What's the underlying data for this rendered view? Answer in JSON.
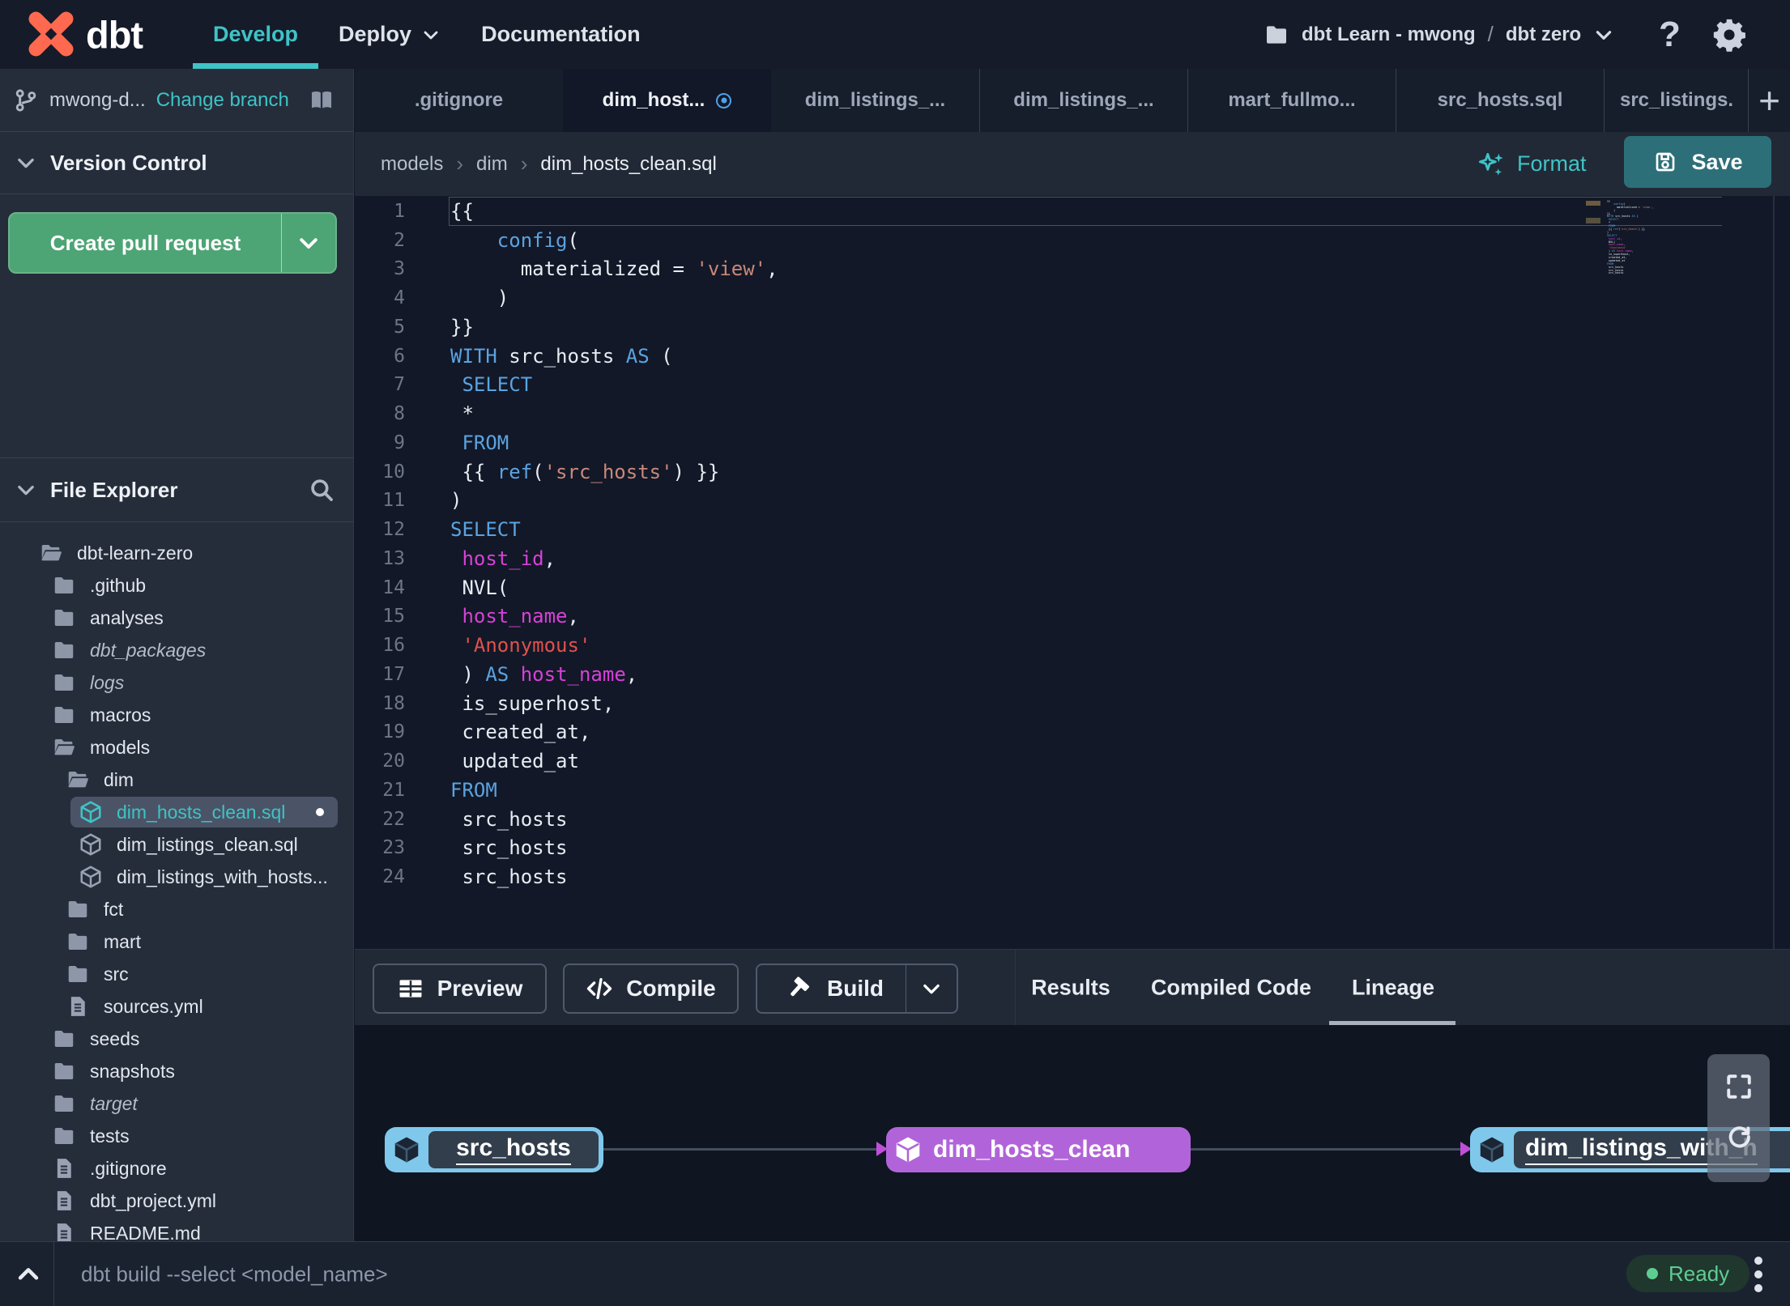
{
  "colors": {
    "accent_teal": "#3fc3c6",
    "logo_orange": "#ff694f",
    "green_button": "#4da475",
    "save_button_teal": "#2d6f78",
    "keyword_blue": "#5ba3e0",
    "string_orange": "#c9887a",
    "string_red": "#e0514d",
    "identifier_magenta": "#d741d7",
    "node_blue": "#7fc8ec",
    "node_purple": "#b164d9",
    "ready_green": "#5ecd92",
    "modified_dot_blue": "#4da3e8"
  },
  "topnav": {
    "brand": "dbt",
    "items": [
      {
        "label": "Develop",
        "active": true,
        "has_dropdown": false
      },
      {
        "label": "Deploy",
        "active": false,
        "has_dropdown": true
      },
      {
        "label": "Documentation",
        "active": false,
        "has_dropdown": false
      }
    ],
    "project_account": "dbt Learn - mwong",
    "project_separator": "/",
    "project_name": "dbt zero",
    "help_label": "?"
  },
  "sidebar": {
    "branch_name": "mwong-d...",
    "change_branch_label": "Change branch",
    "version_control_title": "Version Control",
    "create_pr_label": "Create pull request",
    "file_explorer_title": "File Explorer",
    "tree": [
      {
        "label": "dbt-learn-zero",
        "type": "folder-open",
        "level": 0
      },
      {
        "label": ".github",
        "type": "folder",
        "level": 1
      },
      {
        "label": "analyses",
        "type": "folder",
        "level": 1
      },
      {
        "label": "dbt_packages",
        "type": "folder",
        "level": 1,
        "italic": true
      },
      {
        "label": "logs",
        "type": "folder",
        "level": 1,
        "italic": true
      },
      {
        "label": "macros",
        "type": "folder",
        "level": 1
      },
      {
        "label": "models",
        "type": "folder-open",
        "level": 1
      },
      {
        "label": "dim",
        "type": "folder-open",
        "level": 2
      },
      {
        "label": "dim_hosts_clean.sql",
        "type": "model",
        "level": 3,
        "selected": true,
        "modified": true
      },
      {
        "label": "dim_listings_clean.sql",
        "type": "model",
        "level": 3
      },
      {
        "label": "dim_listings_with_hosts...",
        "type": "model",
        "level": 3
      },
      {
        "label": "fct",
        "type": "folder",
        "level": 2
      },
      {
        "label": "mart",
        "type": "folder",
        "level": 2
      },
      {
        "label": "src",
        "type": "folder",
        "level": 2
      },
      {
        "label": "sources.yml",
        "type": "file",
        "level": 2
      },
      {
        "label": "seeds",
        "type": "folder",
        "level": 1
      },
      {
        "label": "snapshots",
        "type": "folder",
        "level": 1
      },
      {
        "label": "target",
        "type": "folder",
        "level": 1,
        "italic": true
      },
      {
        "label": "tests",
        "type": "folder",
        "level": 1
      },
      {
        "label": ".gitignore",
        "type": "file",
        "level": 1
      },
      {
        "label": "dbt_project.yml",
        "type": "file",
        "level": 1
      },
      {
        "label": "README.md",
        "type": "file",
        "level": 1
      }
    ]
  },
  "tabs": [
    {
      "label": ".gitignore"
    },
    {
      "label": "dim_host...",
      "active": true,
      "modified": true
    },
    {
      "label": "dim_listings_..."
    },
    {
      "label": "dim_listings_..."
    },
    {
      "label": "mart_fullmo..."
    },
    {
      "label": "src_hosts.sql"
    },
    {
      "label": "src_listings.",
      "last": true
    }
  ],
  "editor": {
    "breadcrumb": [
      "models",
      "dim",
      "dim_hosts_clean.sql"
    ],
    "format_label": "Format",
    "save_label": "Save",
    "lines": [
      {
        "n": 1,
        "t": [
          [
            "p",
            "{{"
          ]
        ]
      },
      {
        "n": 2,
        "t": [
          [
            "p",
            "    "
          ],
          [
            "k",
            "config"
          ],
          [
            "p",
            "("
          ]
        ]
      },
      {
        "n": 3,
        "t": [
          [
            "p",
            "      materialized = "
          ],
          [
            "s",
            "'view'"
          ],
          [
            "p",
            ","
          ]
        ]
      },
      {
        "n": 4,
        "t": [
          [
            "p",
            "    )"
          ]
        ]
      },
      {
        "n": 5,
        "t": [
          [
            "p",
            "}}"
          ]
        ]
      },
      {
        "n": 6,
        "t": [
          [
            "k",
            "WITH"
          ],
          [
            "p",
            " src_hosts "
          ],
          [
            "k",
            "AS"
          ],
          [
            "p",
            " ("
          ]
        ]
      },
      {
        "n": 7,
        "t": [
          [
            "p",
            " "
          ],
          [
            "k",
            "SELECT"
          ]
        ]
      },
      {
        "n": 8,
        "t": [
          [
            "p",
            " *"
          ]
        ]
      },
      {
        "n": 9,
        "t": [
          [
            "p",
            " "
          ],
          [
            "k",
            "FROM"
          ]
        ]
      },
      {
        "n": 10,
        "t": [
          [
            "p",
            " {{ "
          ],
          [
            "k",
            "ref"
          ],
          [
            "p",
            "("
          ],
          [
            "s",
            "'src_hosts'"
          ],
          [
            "p",
            ") }}"
          ]
        ]
      },
      {
        "n": 11,
        "t": [
          [
            "p",
            ")"
          ]
        ]
      },
      {
        "n": 12,
        "t": [
          [
            "k",
            "SELECT"
          ]
        ]
      },
      {
        "n": 13,
        "t": [
          [
            "p",
            " "
          ],
          [
            "m",
            "host_id"
          ],
          [
            "p",
            ","
          ]
        ]
      },
      {
        "n": 14,
        "t": [
          [
            "p",
            " NVL("
          ]
        ]
      },
      {
        "n": 15,
        "t": [
          [
            "p",
            " "
          ],
          [
            "m",
            "host_name"
          ],
          [
            "p",
            ","
          ]
        ]
      },
      {
        "n": 16,
        "t": [
          [
            "p",
            " "
          ],
          [
            "r",
            "'Anonymous'"
          ]
        ]
      },
      {
        "n": 17,
        "t": [
          [
            "p",
            " ) "
          ],
          [
            "k",
            "AS"
          ],
          [
            "p",
            " "
          ],
          [
            "m",
            "host_name"
          ],
          [
            "p",
            ","
          ]
        ]
      },
      {
        "n": 18,
        "t": [
          [
            "p",
            " is_superhost,"
          ]
        ]
      },
      {
        "n": 19,
        "t": [
          [
            "p",
            " created_at,"
          ]
        ]
      },
      {
        "n": 20,
        "t": [
          [
            "p",
            " updated_at"
          ]
        ]
      },
      {
        "n": 21,
        "t": [
          [
            "k",
            "FROM"
          ]
        ]
      },
      {
        "n": 22,
        "t": [
          [
            "p",
            " src_hosts"
          ]
        ]
      },
      {
        "n": 23,
        "t": [
          [
            "p",
            " src_hosts"
          ]
        ]
      },
      {
        "n": 24,
        "t": [
          [
            "p",
            " src_hosts"
          ]
        ]
      }
    ]
  },
  "panel": {
    "actions": [
      {
        "label": "Preview",
        "icon": "preview-grid"
      },
      {
        "label": "Compile",
        "icon": "compile-code"
      },
      {
        "label": "Build",
        "icon": "build-hammer",
        "split": true
      }
    ],
    "tabs": [
      {
        "label": "Results"
      },
      {
        "label": "Compiled Code"
      },
      {
        "label": "Lineage",
        "active": true
      }
    ]
  },
  "lineage": {
    "nodes": [
      {
        "label": "src_hosts",
        "variant": "source-selected",
        "underline": true
      },
      {
        "label": "dim_hosts_clean",
        "variant": "model-purple",
        "underline": false
      },
      {
        "label": "dim_listings_with_h",
        "variant": "source-selected",
        "underline": true
      }
    ]
  },
  "statusbar": {
    "command": "dbt build --select <model_name>",
    "status_label": "Ready"
  }
}
